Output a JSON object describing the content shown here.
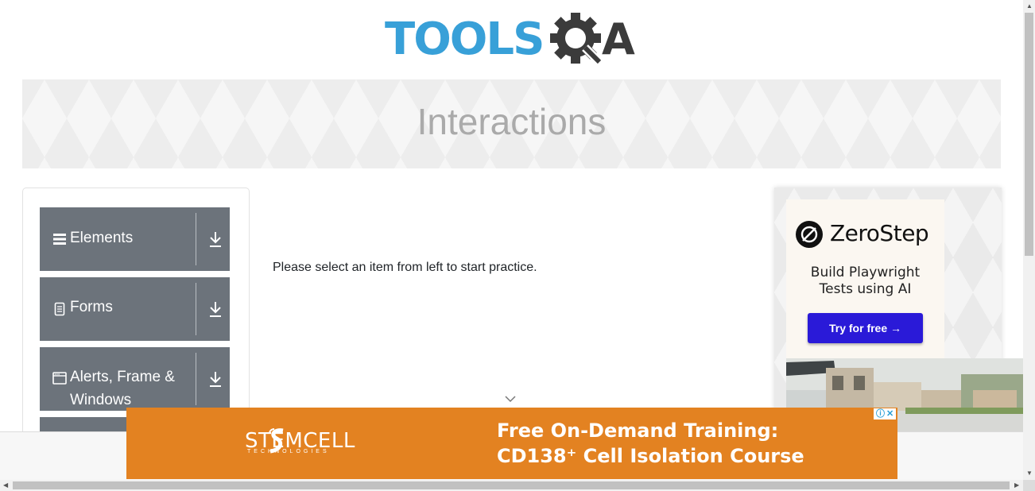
{
  "logo": {
    "text_left": "TOOLS",
    "text_right": "A",
    "colors": {
      "blue": "#38a0d8",
      "dark": "#3b3b3b"
    }
  },
  "header": {
    "title": "Interactions"
  },
  "sidebar": {
    "groups": [
      {
        "label": "Elements",
        "icon": "hamburger-icon"
      },
      {
        "label": "Forms",
        "icon": "document-icon"
      },
      {
        "label": "Alerts, Frame &",
        "label_line2": "Windows",
        "icon": "window-icon"
      }
    ],
    "group_bg": "#6c737b"
  },
  "main": {
    "message": "Please select an item from left to start practice."
  },
  "ad_right": {
    "brand": "ZeroStep",
    "tagline_line1": "Build Playwright",
    "tagline_line2": "Tests using AI",
    "button_label": "Try for free →",
    "button_color": "#2a1ad8"
  },
  "ad_bottom": {
    "brand": "STEMCELL",
    "brand_sub": "TECHNOLOGIES",
    "headline_line1": "Free On-Demand Training:",
    "headline_line2": "CD138⁺ Cell Isolation Course",
    "bg_color": "#e38221"
  }
}
